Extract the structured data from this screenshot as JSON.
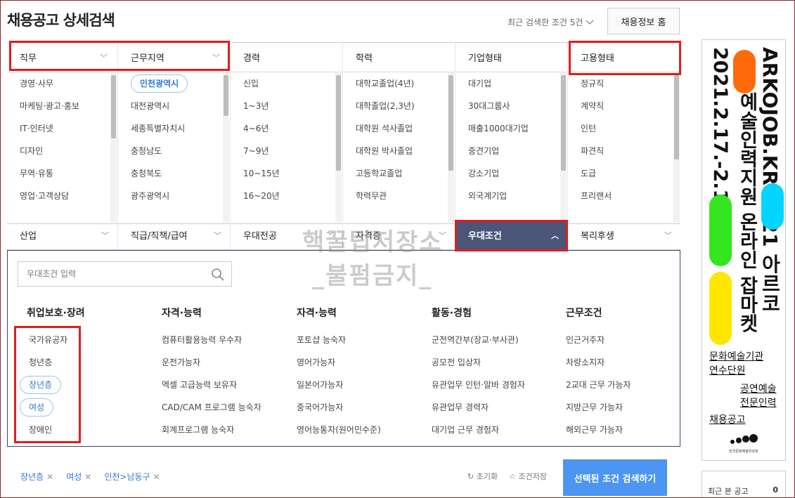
{
  "header": {
    "title": "채용공고 상세검색",
    "recent_conditions": "최근 검색한 조건 5건",
    "home_button": "채용정보 홈"
  },
  "columns": [
    {
      "label": "직무",
      "items": [
        "경영·사무",
        "마케팅·광고·홍보",
        "IT·인터넷",
        "디자인",
        "무역·유통",
        "영업·고객상담"
      ],
      "selected": -1
    },
    {
      "label": "근무지역",
      "items": [
        "인천광역시",
        "대전광역시",
        "세종특별자치시",
        "충청남도",
        "충청북도",
        "광주광역시"
      ],
      "selected": 0
    },
    {
      "label": "경력",
      "items": [
        "신입",
        "1~3년",
        "4~6년",
        "7~9년",
        "10~15년",
        "16~20년"
      ],
      "selected": -1
    },
    {
      "label": "학력",
      "items": [
        "대학교졸업(4년)",
        "대학졸업(2,3년)",
        "대학원 석사졸업",
        "대학원 박사졸업",
        "고등학교졸업",
        "학력무관"
      ],
      "selected": -1
    },
    {
      "label": "기업형태",
      "items": [
        "대기업",
        "30대그룹사",
        "매출1000대기업",
        "중견기업",
        "강소기업",
        "외국계기업"
      ],
      "selected": -1
    },
    {
      "label": "고용형태",
      "items": [
        "정규직",
        "계약직",
        "인턴",
        "파견직",
        "도급",
        "프리랜서"
      ],
      "selected": -1
    }
  ],
  "row2": [
    "산업",
    "직급/직책/급여",
    "우대전공",
    "자격증",
    "우대조건",
    "복리후생"
  ],
  "dropdown": {
    "search_placeholder": "우대조건 입력",
    "groups": [
      {
        "title": "취업보호·장려",
        "options": [
          "국가유공자",
          "청년층",
          "장년층",
          "여성",
          "장애인"
        ],
        "selected": [
          2,
          3
        ]
      },
      {
        "title": "자격·능력",
        "options": [
          "컴퓨터활용능력 우수자",
          "운전가능자",
          "엑셀 고급능력 보유자",
          "CAD/CAM 프로그램 능숙자",
          "회계프로그램 능숙자"
        ],
        "selected": []
      },
      {
        "title": "자격·능력",
        "options": [
          "포토샵 능숙자",
          "영어가능자",
          "일본어가능자",
          "중국어가능자",
          "영어능통자(원어민수준)"
        ],
        "selected": []
      },
      {
        "title": "활동·경험",
        "options": [
          "군전역간부(장교·부사관)",
          "공모전 입상자",
          "유관업무 인턴·알바 경험자",
          "유관업무 경력자",
          "대기업 근무 경험자"
        ],
        "selected": []
      },
      {
        "title": "근무조건",
        "options": [
          "인근거주자",
          "차량소지자",
          "2교대 근무 가능자",
          "지방근무 가능자",
          "해외근무 가능자"
        ],
        "selected": []
      }
    ]
  },
  "selected_chips": [
    "장년층",
    "여성",
    "인천>남동구"
  ],
  "actions": {
    "reset": "초기화",
    "save": "조건저장",
    "search": "선택된 조건 검색하기"
  },
  "watermark": [
    "핵꿀팁저장소",
    "_불펌금지_"
  ],
  "ad": {
    "line1": "ARKOJOB.KR 2021 아르코",
    "line2": "예술인력지원 온라인 잡마켓",
    "line3": "2021.2.17.-2.19.",
    "text1": "문화예술기관",
    "text2": "연수단원",
    "text3": "공연예술",
    "text4": "전문인력",
    "text5": "채용공고",
    "logo": "한국문화예술위원회",
    "colors": {
      "orange": "#ff6a0d",
      "cyan": "#00d4ff",
      "green": "#33e61f",
      "yellow": "#ffe600"
    }
  },
  "recent_viewed": {
    "label": "최근 본 공고",
    "count": "0"
  },
  "colors": {
    "accent": "#4c95f0",
    "active_tab": "#4b5679",
    "highlight": "#e01d1d",
    "selected_text": "#2e79d6"
  }
}
